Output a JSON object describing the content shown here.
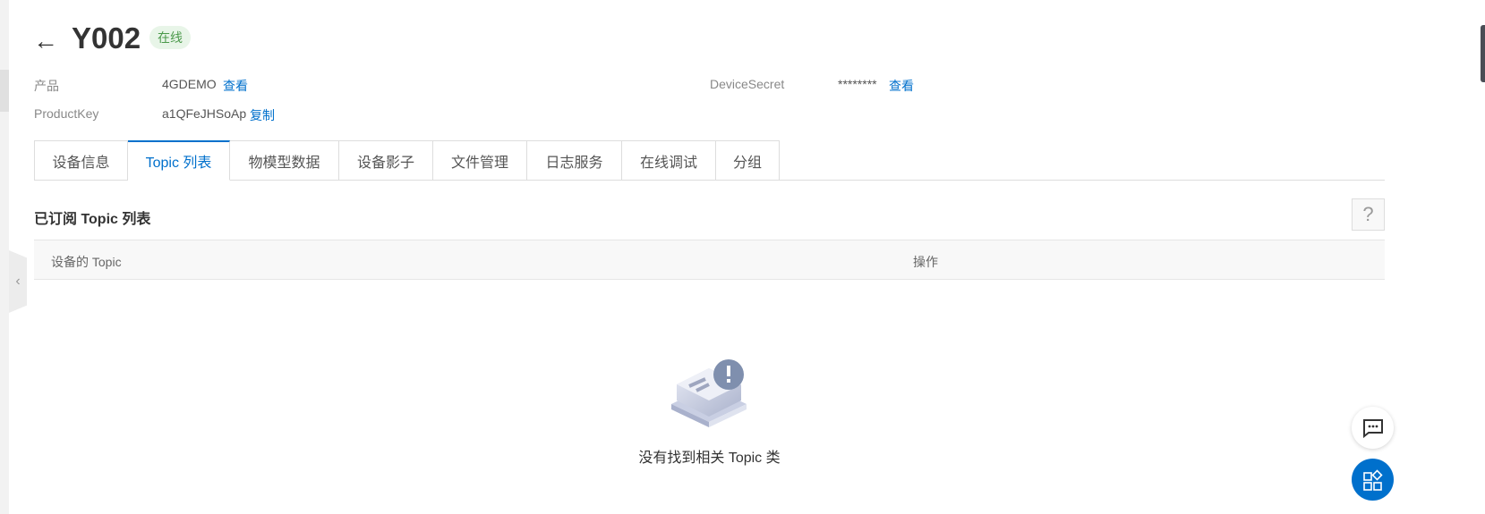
{
  "header": {
    "title": "Y002",
    "status": "在线",
    "back_icon": "arrow-left-icon"
  },
  "info": {
    "product_label": "产品",
    "product_value": "4GDEMO",
    "product_link": "查看",
    "productkey_label": "ProductKey",
    "productkey_value": "a1QFeJHSoAp",
    "productkey_link": "复制",
    "secret_label": "DeviceSecret",
    "secret_value": "********",
    "secret_link": "查看"
  },
  "tabs": [
    {
      "label": "设备信息"
    },
    {
      "label": "Topic 列表"
    },
    {
      "label": "物模型数据"
    },
    {
      "label": "设备影子"
    },
    {
      "label": "文件管理"
    },
    {
      "label": "日志服务"
    },
    {
      "label": "在线调试"
    },
    {
      "label": "分组"
    }
  ],
  "active_tab": "Topic 列表",
  "section": {
    "title": "已订阅 Topic 列表",
    "help": "?"
  },
  "table": {
    "columns": [
      "设备的 Topic",
      "操作"
    ],
    "empty_text": "没有找到相关 Topic 类"
  },
  "colors": {
    "accent": "#0070cc",
    "online_bg": "#e8f5e8",
    "online_text": "#4c9a4c"
  }
}
